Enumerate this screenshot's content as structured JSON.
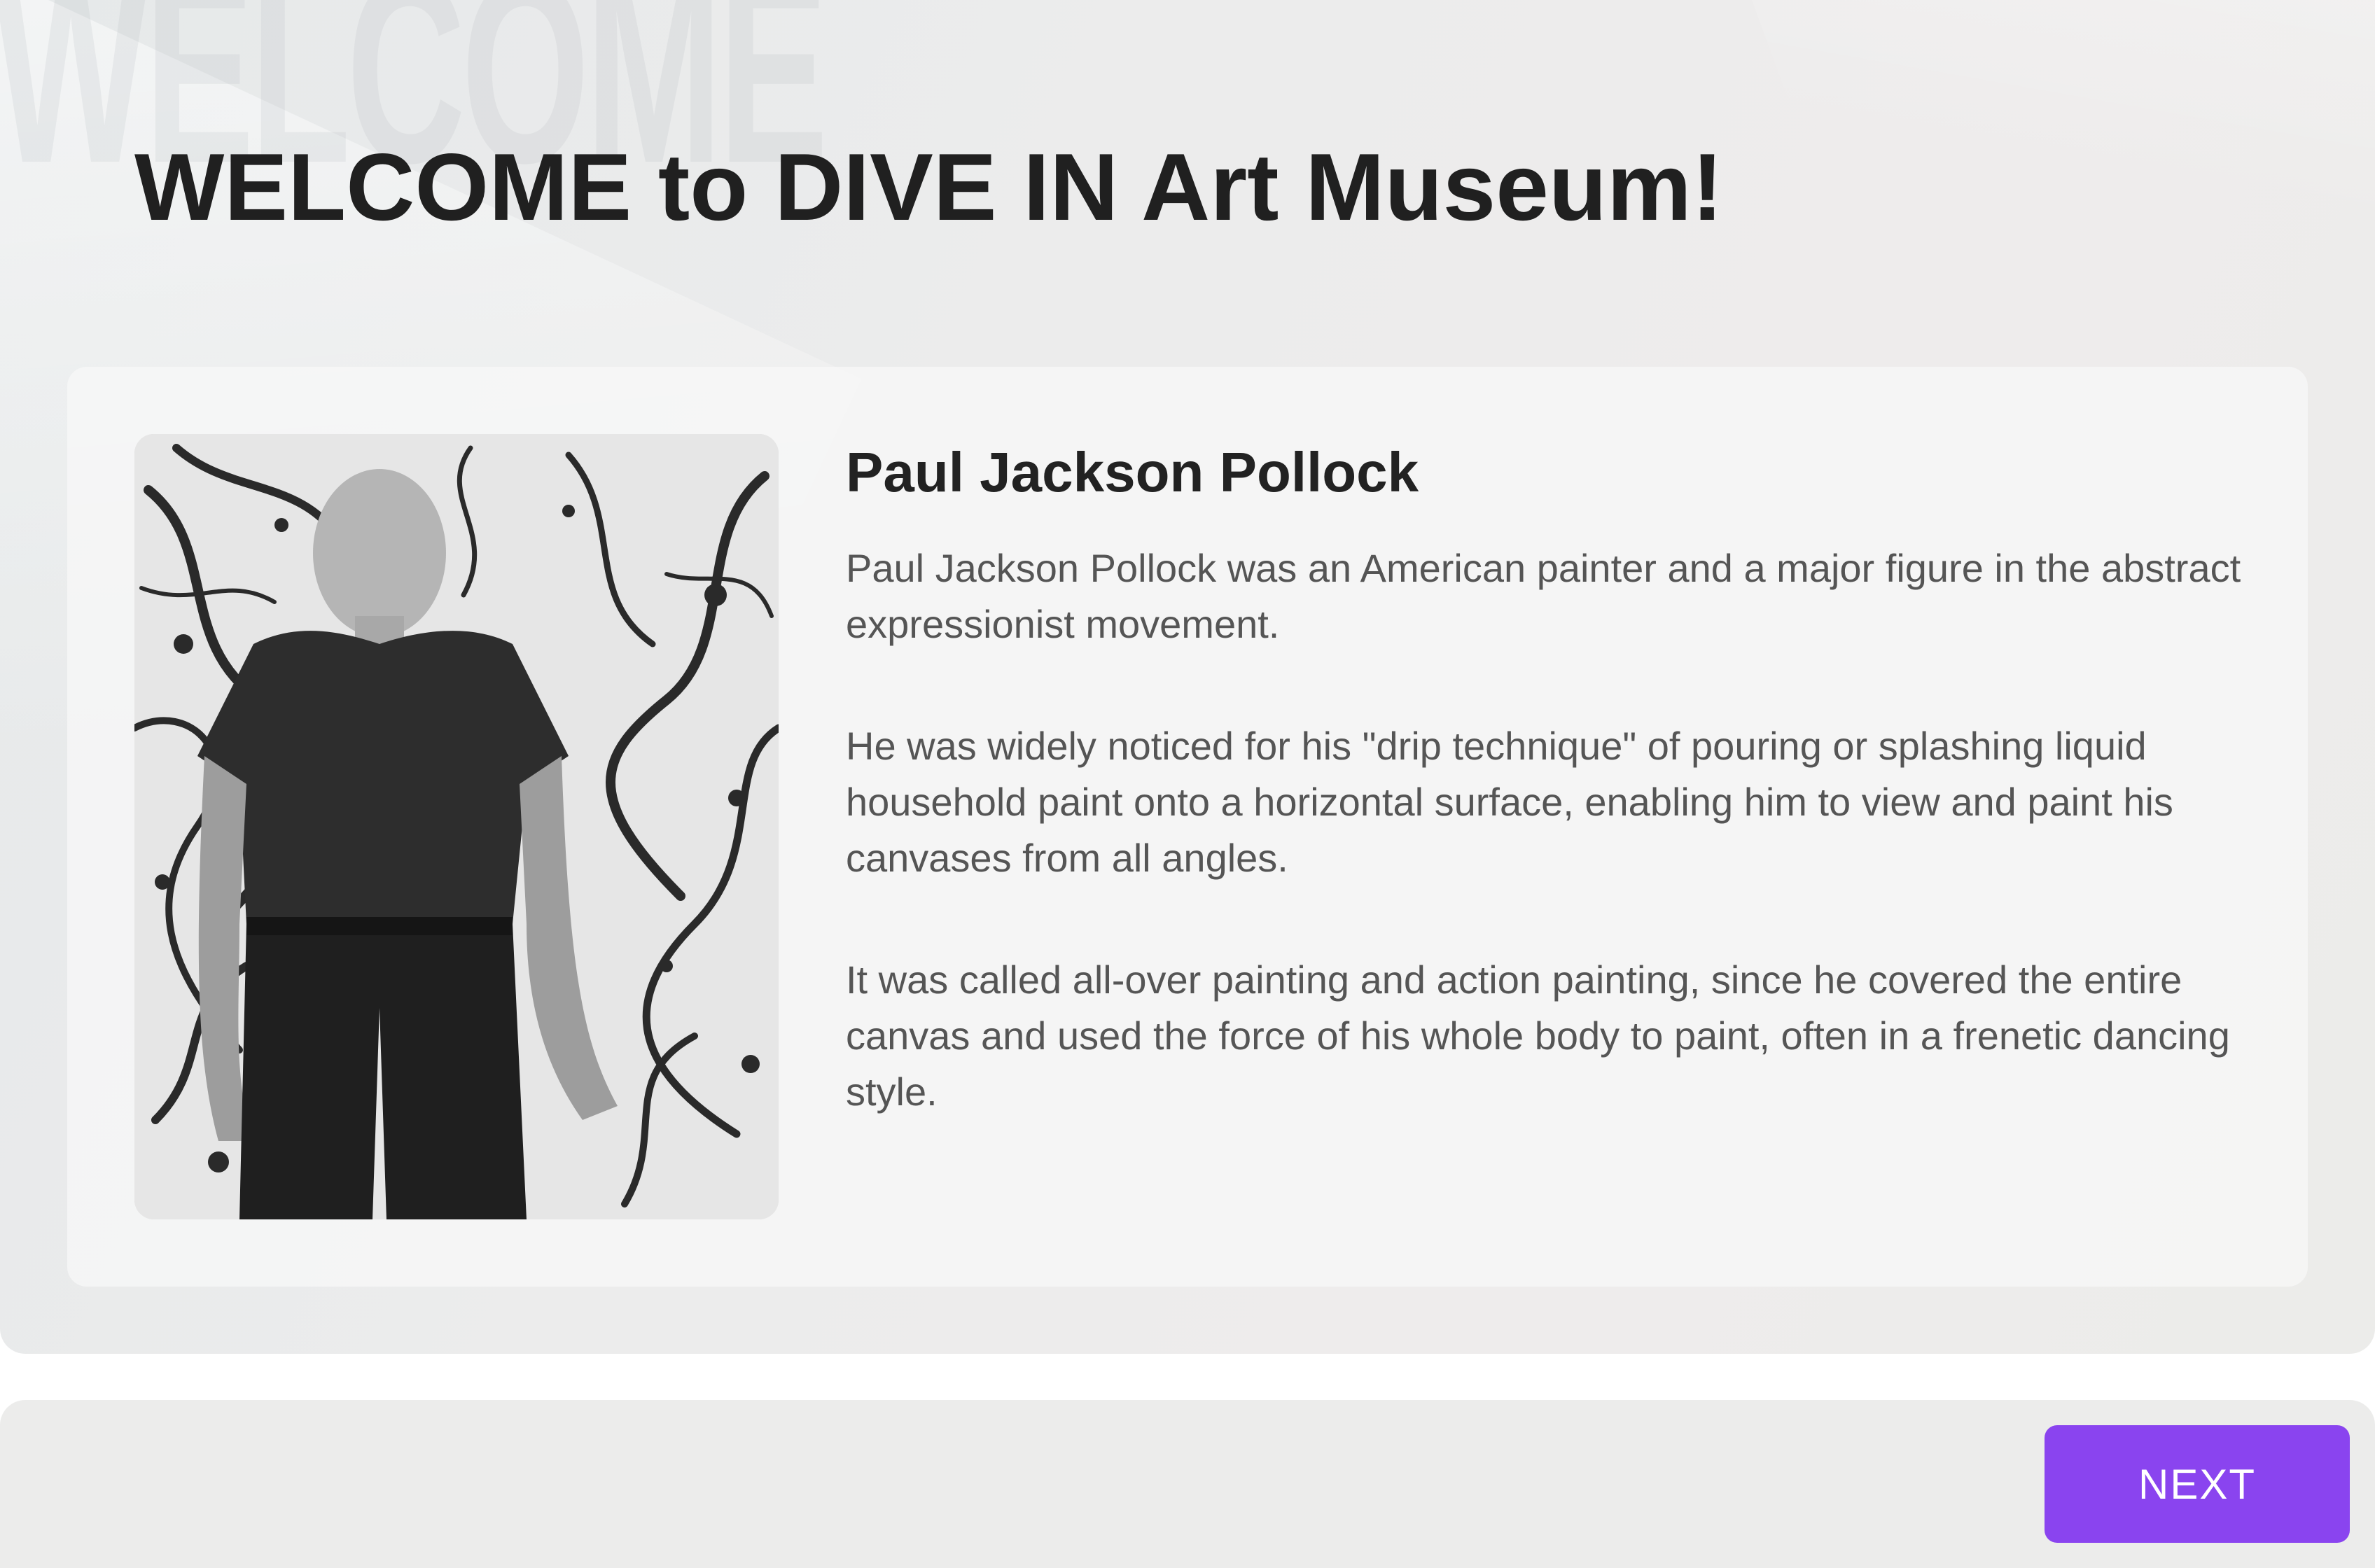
{
  "hero": {
    "watermark_text": "WELCOME",
    "title": "WELCOME to DIVE IN Art Museum!"
  },
  "artist": {
    "name": "Paul Jackson Pollock",
    "paragraphs": [
      "Paul Jackson Pollock was an American painter and a major figure in the abstract expressionist movement.",
      "He was widely noticed for his \"drip technique\" of pouring or splashing liquid household paint onto a horizontal surface, enabling him to view and paint his canvases from all angles.",
      "It was called all-over painting and action painting, since he covered the entire canvas and used the force of his whole body to paint, often in a frenetic dancing style."
    ],
    "portrait_icon": "artist-portrait-photo"
  },
  "footer": {
    "next_label": "NEXT"
  },
  "colors": {
    "accent": "#8a44ef",
    "title_text": "#202020",
    "body_text": "#555555"
  }
}
